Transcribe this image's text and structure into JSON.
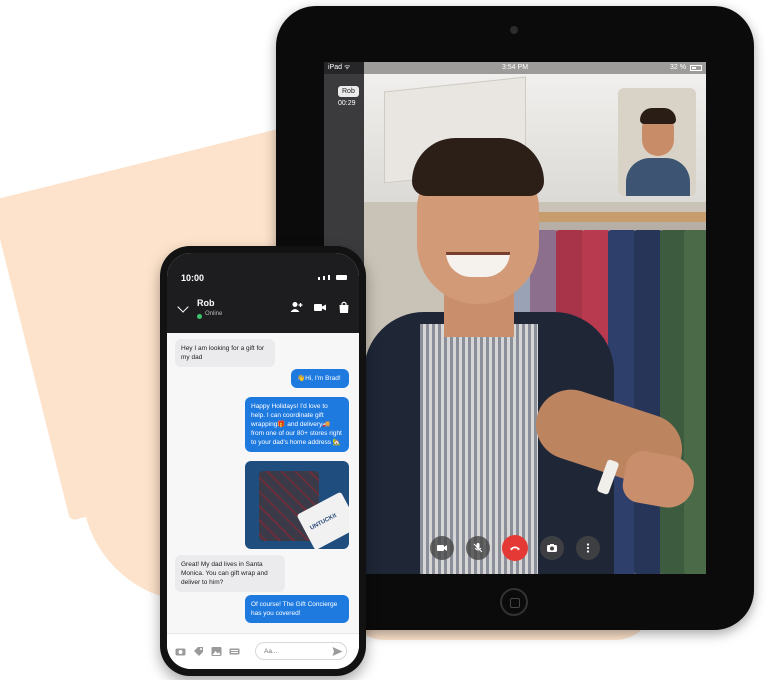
{
  "ipad": {
    "status_left": "iPad ᯤ",
    "status_time": "3:54 PM",
    "status_battery": "32 %",
    "caller_tag": "Rob",
    "call_timer": "00:29",
    "controls": [
      "video-icon",
      "mic-off-icon",
      "end-call-icon",
      "camera-icon",
      "more-icon"
    ]
  },
  "phone": {
    "time": "10:00",
    "contact_name": "Rob",
    "online_label": "Online",
    "messages": [
      {
        "from": "customer",
        "text": "Hey I am looking for a gift for my dad"
      },
      {
        "from": "associate",
        "text": "👋Hi, I'm Brad!"
      },
      {
        "from": "associate",
        "text": "Happy Holidays! I'd love to help. I can coordinate gift wrapping🎁 and delivery🚚 from one of our 80+ stores right to your dad's home address 🏡"
      },
      {
        "from": "customer",
        "text": "Great! My dad lives in Santa Monica. You can gift wrap and deliver to him?"
      },
      {
        "from": "associate",
        "text": "Of course! The Gift Concierge has you covered!"
      }
    ],
    "image_box_label": "UNTUCKit",
    "input_placeholder": "Aa..."
  },
  "colors": {
    "accent_blue": "#1f7ae0",
    "background_peach": "#fde3cb",
    "end_call_red": "#e53935",
    "online_green": "#3ec46d"
  }
}
